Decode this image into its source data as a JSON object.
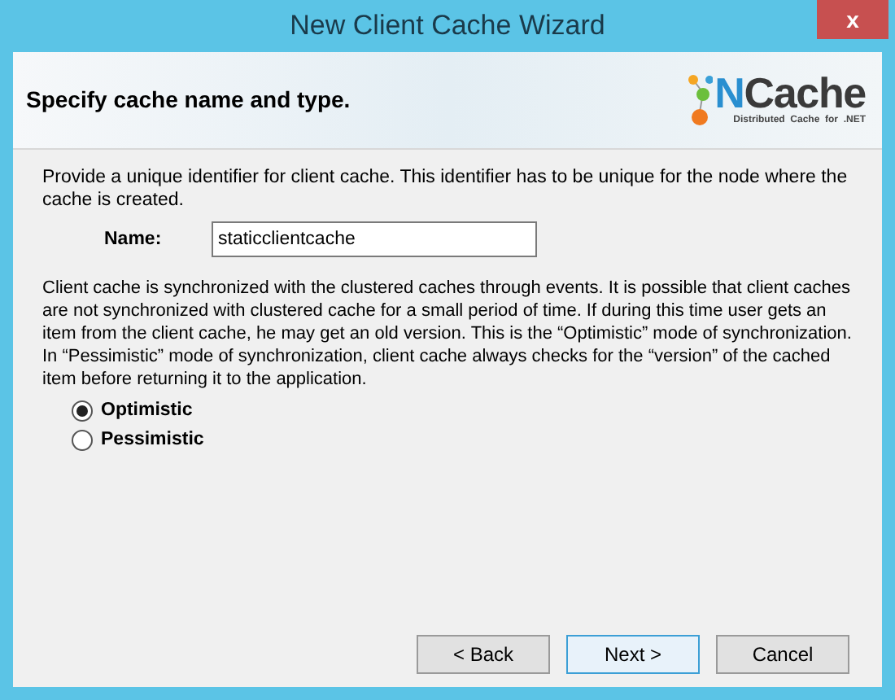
{
  "window": {
    "title": "New Client Cache Wizard",
    "close": "x"
  },
  "header": {
    "title": "Specify cache name and type.",
    "logo": {
      "prefix": "N",
      "name": "Cache",
      "tagline": "Distributed  Cache  for  .NET"
    }
  },
  "intro": "Provide a unique identifier for client cache. This identifier has to be unique for the node where the cache is created.",
  "name_field": {
    "label": "Name:",
    "value": "staticclientcache"
  },
  "description": "Client cache is synchronized with the clustered caches through events. It is possible that client caches are not synchronized with clustered cache for a small period of time. If during this time user gets an item from the client cache, he may get an old version. This is the “Optimistic” mode of synchronization. In “Pessimistic” mode of synchronization, client cache always checks for the “version” of the cached item before returning it to the application.",
  "modes": [
    {
      "label": "Optimistic",
      "selected": true
    },
    {
      "label": "Pessimistic",
      "selected": false
    }
  ],
  "buttons": [
    {
      "label": "< Back",
      "focused": false
    },
    {
      "label": "Next >",
      "focused": true
    },
    {
      "label": "Cancel",
      "focused": false
    }
  ]
}
